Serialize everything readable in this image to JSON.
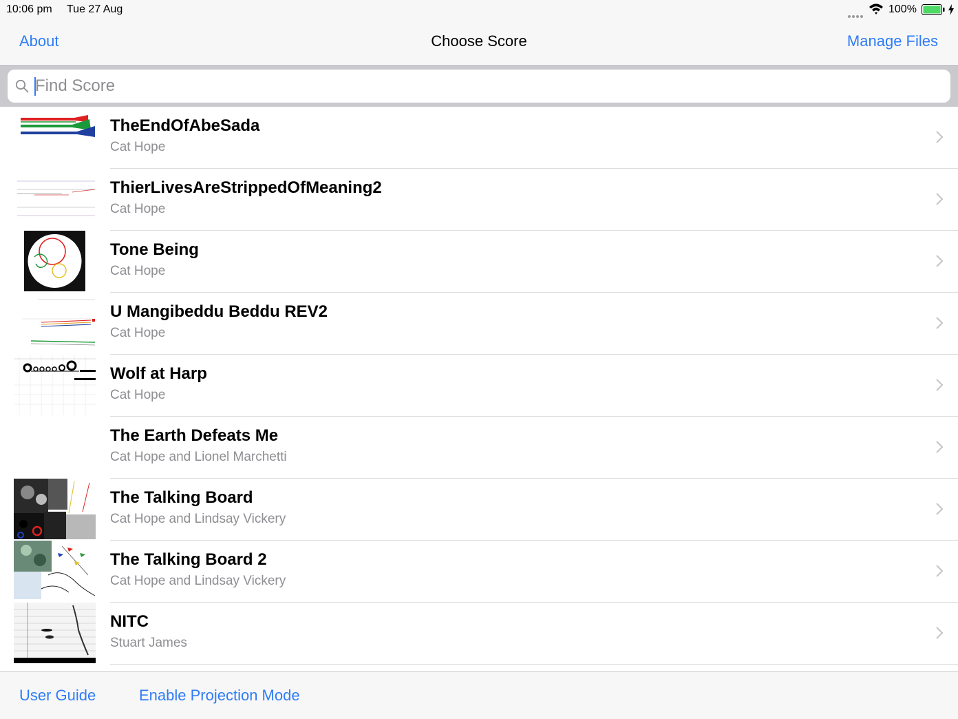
{
  "status_bar": {
    "time": "10:06 pm",
    "date": "Tue 27 Aug",
    "battery_percent": "100%",
    "battery_level": 1.0,
    "battery_color": "#4cd964"
  },
  "nav": {
    "left_button": "About",
    "title": "Choose Score",
    "right_button": "Manage Files"
  },
  "search": {
    "placeholder": "Find Score",
    "value": ""
  },
  "scores": [
    {
      "title": "TheEndOfAbeSada",
      "author": "Cat Hope",
      "thumbnail": "colored-wedges-thumbnail"
    },
    {
      "title": "ThierLivesAreStrippedOfMeaning2",
      "author": "Cat Hope",
      "thumbnail": "faint-lines-thumbnail"
    },
    {
      "title": "Tone Being",
      "author": "Cat Hope",
      "thumbnail": "circle-score-thumbnail"
    },
    {
      "title": "U Mangibeddu Beddu REV2",
      "author": "Cat Hope",
      "thumbnail": "colored-lines-thumbnail"
    },
    {
      "title": "Wolf at Harp",
      "author": "Cat Hope",
      "thumbnail": "circles-grid-thumbnail"
    },
    {
      "title": "The Earth Defeats Me",
      "author": "Cat Hope and Lionel Marchetti",
      "thumbnail": "blank-thumbnail"
    },
    {
      "title": "The Talking Board",
      "author": "Cat Hope and Lindsay Vickery",
      "thumbnail": "collage-thumbnail"
    },
    {
      "title": "The Talking Board 2",
      "author": "Cat Hope and Lindsay Vickery",
      "thumbnail": "collage-green-thumbnail"
    },
    {
      "title": "NITC",
      "author": "Stuart James",
      "thumbnail": "staff-score-thumbnail"
    }
  ],
  "toolbar": {
    "user_guide": "User Guide",
    "projection_mode": "Enable Projection Mode"
  },
  "colors": {
    "accent": "#2f7cf6",
    "secondary_text": "#8e8e93",
    "bar_background": "#f7f7f7"
  }
}
